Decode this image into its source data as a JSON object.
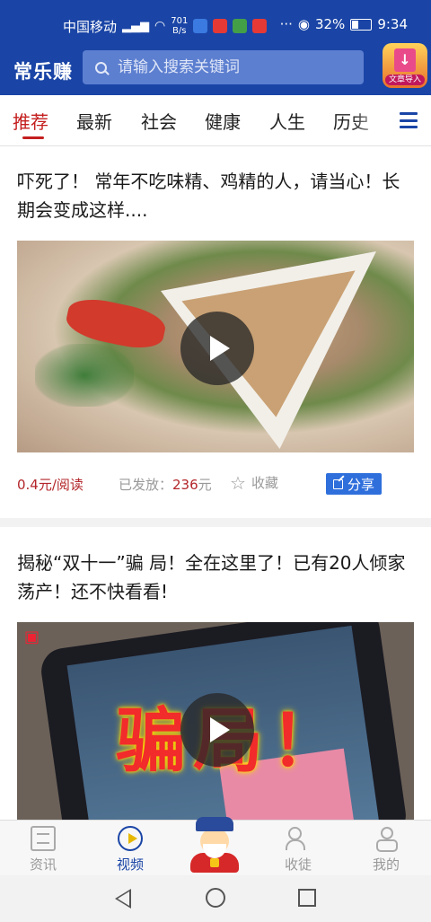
{
  "status_bar": {
    "carrier": "中国移动",
    "network_speed_value": "701",
    "network_speed_unit": "B/s",
    "battery": "32%",
    "time": "9:34"
  },
  "header": {
    "brand": "常乐赚",
    "search_placeholder": "请输入搜索关键词",
    "import_label": "文章导入"
  },
  "tabs": [
    {
      "label": "推荐",
      "active": true
    },
    {
      "label": "最新"
    },
    {
      "label": "社会"
    },
    {
      "label": "健康"
    },
    {
      "label": "人生"
    },
    {
      "label": "历史"
    }
  ],
  "articles": [
    {
      "title": "吓死了！ 常年不吃味精、鸡精的人，请当心！长期会变成这样....",
      "price": "0.4元/阅读",
      "issued_label": "已发放：",
      "issued_amount": "236",
      "issued_unit": "元",
      "favorite_label": "收藏",
      "share_label": "分享"
    },
    {
      "title": "揭秘“双十一”骗 局！全在这里了！已有20人倾家荡产！还不快看看!",
      "thumbnail_text": "骗局！"
    }
  ],
  "bottom_nav": [
    {
      "label": "资讯",
      "icon": "news-icon"
    },
    {
      "label": "视频",
      "icon": "video-icon",
      "active": true
    },
    {
      "label": "",
      "icon": "mascot-icon"
    },
    {
      "label": "收徒",
      "icon": "users-icon"
    },
    {
      "label": "我的",
      "icon": "profile-icon"
    }
  ],
  "colors": {
    "header_blue": "#1a45a6",
    "accent_red": "#c41e1e",
    "share_blue": "#2f6fdc"
  }
}
